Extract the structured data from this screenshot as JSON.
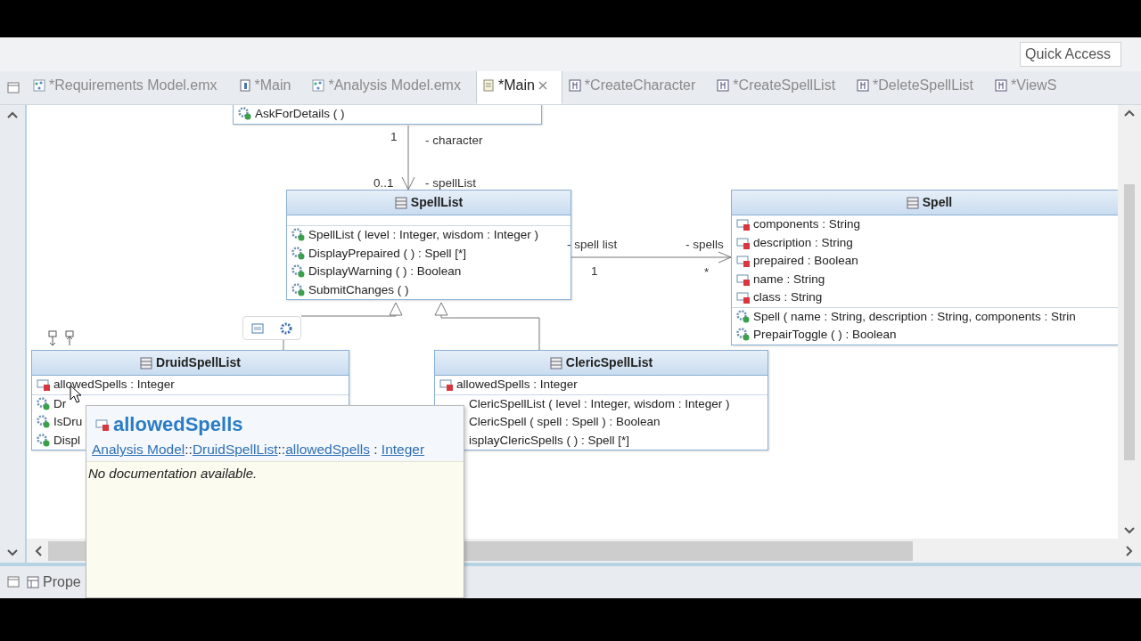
{
  "toolbar": {
    "quick_access": {
      "placeholder": "Quick Access"
    }
  },
  "editor_tabs": [
    {
      "label": "*Requirements Model.emx",
      "kind": "model",
      "selected": false
    },
    {
      "label": "*Main",
      "kind": "diagram",
      "selected": false
    },
    {
      "label": "*Analysis Model.emx",
      "kind": "model",
      "selected": false
    },
    {
      "label": "*Main",
      "kind": "class-diagram",
      "selected": true
    },
    {
      "label": "*CreateCharacter",
      "kind": "sequence",
      "selected": false
    },
    {
      "label": "*CreateSpellList",
      "kind": "sequence",
      "selected": false
    },
    {
      "label": "*DeleteSpellList",
      "kind": "sequence",
      "selected": false
    },
    {
      "label": "*ViewS",
      "kind": "sequence",
      "selected": false
    }
  ],
  "diagram": {
    "classes": [
      {
        "operations": [
          {
            "text": "AskForDetails ( )",
            "icon": true
          }
        ]
      },
      {
        "name": "SpellList",
        "operations": [
          {
            "text": "SpellList ( level : Integer, wisdom : Integer )",
            "icon": true
          },
          {
            "text": "DisplayPrepaired ( ) : Spell [*]",
            "icon": true
          },
          {
            "text": "DisplayWarning ( ) : Boolean",
            "icon": true
          },
          {
            "text": "SubmitChanges ( )",
            "icon": true
          }
        ]
      },
      {
        "name": "Spell",
        "attributes": [
          "components : String",
          "description : String",
          "prepaired : Boolean",
          "name : String",
          "class : String"
        ],
        "operations": [
          {
            "text": "Spell ( name : String, description : String, components : Strin",
            "icon": true
          },
          {
            "text": "PrepairToggle ( ) : Boolean",
            "icon": true
          }
        ]
      },
      {
        "name": "DruidSpellList",
        "attributes": [
          "allowedSpells : Integer"
        ],
        "operations": [
          {
            "text": "Dr",
            "icon": true
          },
          {
            "text": "IsDru",
            "icon": true
          },
          {
            "text": "Displ",
            "icon": true
          }
        ]
      },
      {
        "name": "ClericSpellList",
        "attributes": [
          "allowedSpells : Integer"
        ],
        "operations": [
          {
            "text": "ClericSpellList ( level : Integer, wisdom : Integer )",
            "icon": false
          },
          {
            "text": "ClericSpell ( spell : Spell ) : Boolean",
            "icon": false
          },
          {
            "text": "isplayClericSpells ( ) : Spell [*]",
            "icon": false
          }
        ]
      }
    ],
    "connectors": [
      {
        "kind": "association",
        "labels": [
          "1",
          "- character",
          "0..1",
          "- spellList"
        ]
      },
      {
        "kind": "association",
        "labels": [
          "- spell list",
          "1",
          "- spells",
          "*"
        ]
      },
      {
        "kind": "generalization"
      },
      {
        "kind": "generalization"
      }
    ]
  },
  "tooltip": {
    "title": "allowedSpells",
    "path": [
      {
        "text": "Analysis Model",
        "link": true
      },
      {
        "text": "::",
        "link": false
      },
      {
        "text": "DruidSpellList",
        "link": true
      },
      {
        "text": "::",
        "link": false
      },
      {
        "text": "allowedSpells",
        "link": true
      },
      {
        "text": " : ",
        "link": false
      },
      {
        "text": "Integer",
        "link": true
      }
    ],
    "documentation": "No documentation available."
  },
  "bottom_panel": {
    "tabs": [
      {
        "label": "Prope"
      }
    ]
  }
}
